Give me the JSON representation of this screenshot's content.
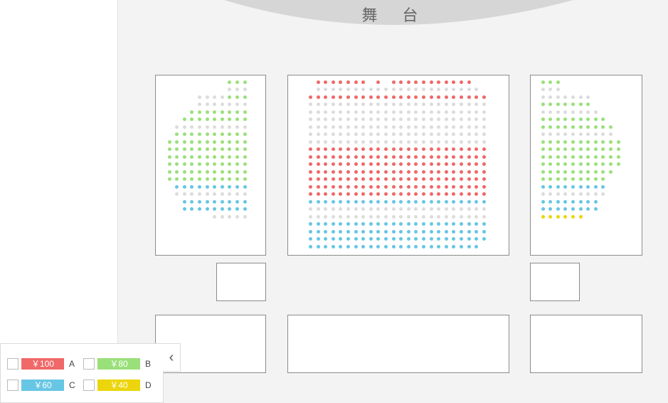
{
  "stage": {
    "label": "舞 台"
  },
  "legend": {
    "items": [
      {
        "price": "￥100",
        "grade": "A",
        "color": "#f06868"
      },
      {
        "price": "￥80",
        "grade": "B",
        "color": "#9ae07a"
      },
      {
        "price": "￥60",
        "grade": "C",
        "color": "#67c6e4"
      },
      {
        "price": "￥40",
        "grade": "D",
        "color": "#ecd50a"
      }
    ],
    "collapse_icon": "‹"
  },
  "colors": {
    "a": "#f06868",
    "b": "#9ae07a",
    "c": "#67c6e4",
    "d": "#ecd50a",
    "sold": "#dcdcdc",
    "stage": "#d6d6d6",
    "background": "#f3f3f3"
  },
  "seatmap": {
    "center": {
      "rows": [
        "_AAAAAAA_A_AAAAAAAAAAA__",
        "_XXXXXXXXXXXXXXXXXXXXXX_",
        "AAAAAAAAAAAAAAAAAAAAAAAA",
        "XXXXXXXXXXXXXXXXXXXXXXXX",
        "XXXXXXXXXXXXXXXXXXXXXXXX",
        "XXXXXXXXXXXXXXXXXXXXXXXX",
        "XXXXXXXXXXXXXXXXXXXXXXXX",
        "XXXXXXXXXXXXXXXXXXXXXXXX",
        "XXXXXXXXXXXXXXXXXXXXXXXX",
        "AAAAAAAAAAAAAAAAAAAAAAAA",
        "AAAAAAAAAAAAAAAAAAAAAAAA",
        "AAAAAAAAAAAAAAAAAAAAAAAA",
        "AAAAAAAAAAAAAAAAAAAAAAAA",
        "AAAAAAAAAAAAAAAAAAAAAAAA",
        "AAAAAAAAAAAAAAAAAAAAAAAA",
        "AAAAAAAAAAAAAAAAAAAAAAAA",
        "CCCCCCCCCCCCCCCCCCCCCCCC",
        "XXXXXXXXXXXXXXXXXXXXXXXX",
        "XXXXXXXXXXXXXXXXXXXXXXXX",
        "CCCCCCCCCCCCCCCCCCCCCCCC",
        "CCCCCCCCCCCCCCCCCCCCCCCC",
        "CCCCCCCCCCCCCCCCCCCCCCCC",
        "CCCCCCCCCCCCCCCCCCCCCCC_"
      ]
    },
    "left": {
      "rows": [
        "________BBB",
        "________XXX",
        "____XXXXBBB",
        "____XXXXXXX",
        "___BBBBBBBB",
        "__BBBBBBBBB",
        "_XXXXXXXXXX",
        "_BBBBBBBBBB",
        "BBBBBBBBBBB",
        "BBBBBBBBBBB",
        "BBBBBBBBBBB",
        "BBBBBBBBBBB",
        "BBBBBBBBBBB",
        "BBBBBBBBBBB",
        "_CCCCCCCCCC",
        "_XXXXXXXXXX",
        "__CCCCCCCCC",
        "__CCCCCCCCC",
        "______XXXXX"
      ]
    },
    "right": {
      "rows": [
        "BBB________",
        "XXX________",
        "XXXXXXX____",
        "BBBBBBB____",
        "XXXXXXXX___",
        "BBBBBBBBB__",
        "BBBBBBBBBB_",
        "XXXXXXXXXX_",
        "BBBBBBBBBBB",
        "BBBBBBBBBBB",
        "BBBBBBBBBBB",
        "BBBBBBBBBBB",
        "BBBBBBBBBB_",
        "BBBBBBBBB__",
        "CCCCCCCCC__",
        "XXXXXXXXX__",
        "CCCCCCCC___",
        "CCCCCCCC___",
        "DDDDDD_____"
      ]
    }
  }
}
